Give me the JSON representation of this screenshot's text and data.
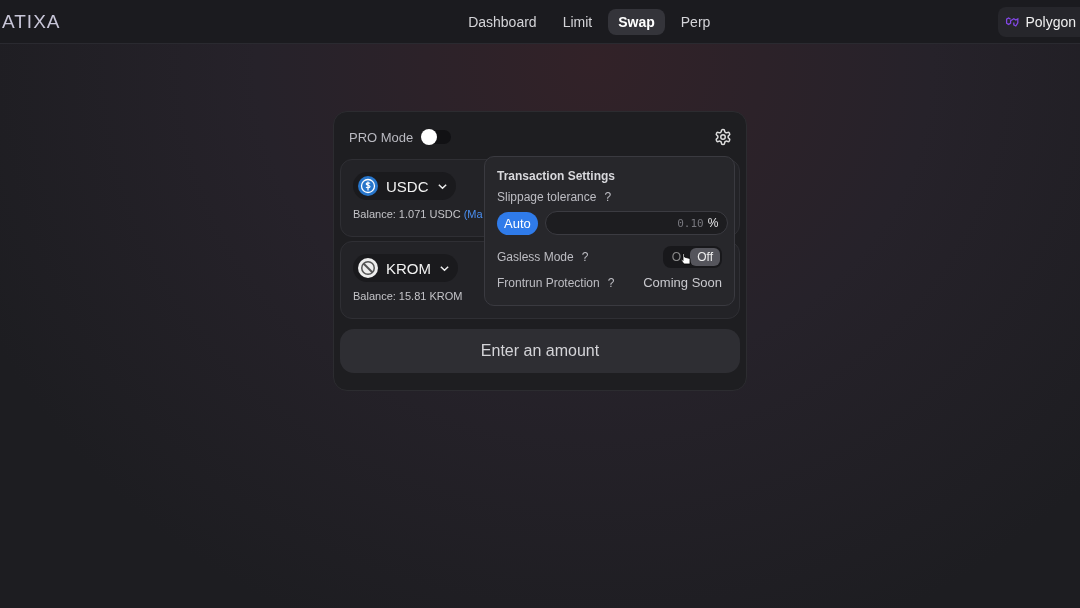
{
  "logo": "ATIXA",
  "nav": [
    {
      "label": "Dashboard",
      "selected": false
    },
    {
      "label": "Limit",
      "selected": false
    },
    {
      "label": "Swap",
      "selected": true
    },
    {
      "label": "Perp",
      "selected": false
    }
  ],
  "network": {
    "label": "Polygon"
  },
  "swap": {
    "pro_mode": {
      "label": "PRO Mode",
      "on": false
    },
    "tokens": [
      {
        "symbol": "USDC",
        "kind": "usdc",
        "balance": "Balance: 1.071 USDC",
        "max_link": "(Ma"
      },
      {
        "symbol": "KROM",
        "kind": "krom",
        "balance": "Balance: 15.81 KROM"
      }
    ],
    "submit": "Enter an amount"
  },
  "settings": {
    "title": "Transaction Settings",
    "slippage": {
      "label": "Slippage tolerance",
      "help": "?",
      "auto": "Auto",
      "auto_selected": true,
      "placeholder": "0.10",
      "unit": "%"
    },
    "gasless": {
      "label": "Gasless Mode",
      "help": "?",
      "options": [
        {
          "label": "O",
          "selected": false
        },
        {
          "label": "Off",
          "selected": true
        }
      ]
    },
    "frontrun": {
      "label": "Frontrun Protection",
      "help": "?",
      "value": "Coming Soon"
    }
  }
}
